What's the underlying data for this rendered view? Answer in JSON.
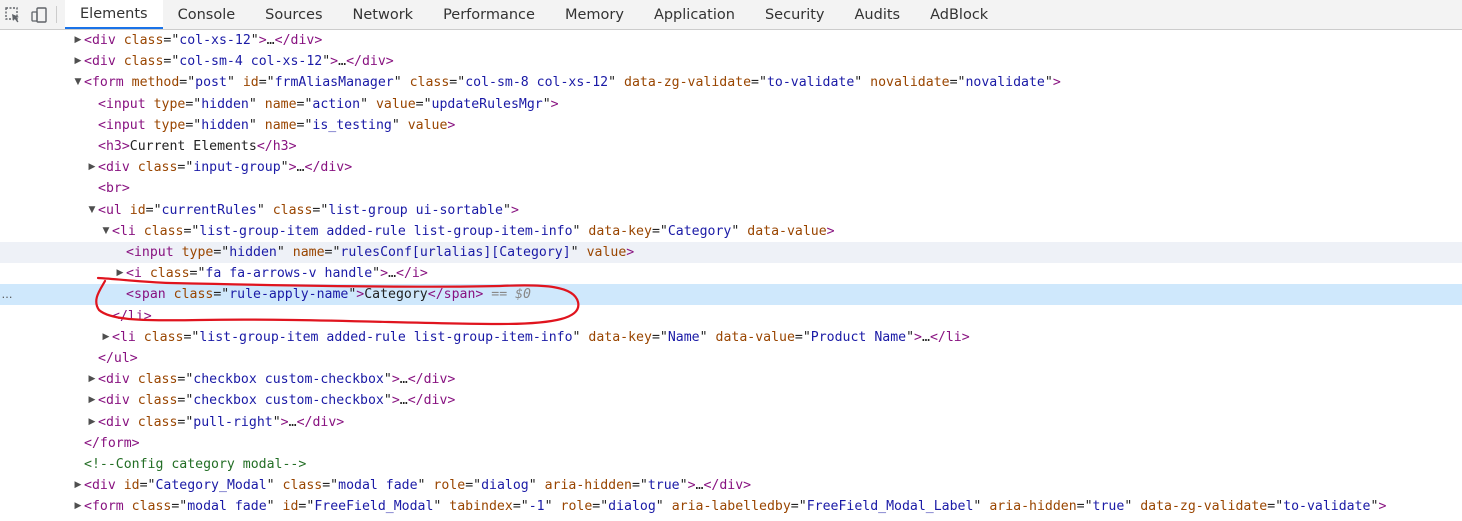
{
  "toolbar": {
    "icons": [
      "inspect-element-icon",
      "device-toggle-icon"
    ],
    "tabs": [
      {
        "label": "Elements",
        "active": true
      },
      {
        "label": "Console"
      },
      {
        "label": "Sources"
      },
      {
        "label": "Network"
      },
      {
        "label": "Performance"
      },
      {
        "label": "Memory"
      },
      {
        "label": "Application"
      },
      {
        "label": "Security"
      },
      {
        "label": "Audits"
      },
      {
        "label": "AdBlock"
      }
    ]
  },
  "colors": {
    "tag": "#881280",
    "attr_name": "#994500",
    "attr_value": "#1a1aa6",
    "comment": "#236e25",
    "selection": "#cfe8fc",
    "annotation": "#e0141e"
  },
  "tree": [
    {
      "depth": 0,
      "tri": "closed",
      "tag": "div",
      "attrs": [
        [
          "class",
          "col-xs-12"
        ]
      ],
      "collapsed": true
    },
    {
      "depth": 0,
      "tri": "closed",
      "tag": "div",
      "attrs": [
        [
          "class",
          "col-sm-4 col-xs-12"
        ]
      ],
      "collapsed": true
    },
    {
      "depth": 0,
      "tri": "open",
      "tag": "form",
      "attrs": [
        [
          "method",
          "post"
        ],
        [
          "id",
          "frmAliasManager"
        ],
        [
          "class",
          "col-sm-8 col-xs-12"
        ],
        [
          "data-zg-validate",
          "to-validate"
        ],
        [
          "novalidate",
          "novalidate"
        ]
      ]
    },
    {
      "depth": 1,
      "tag": "input",
      "attrs": [
        [
          "type",
          "hidden"
        ],
        [
          "name",
          "action"
        ],
        [
          "value",
          "updateRulesMgr"
        ]
      ]
    },
    {
      "depth": 1,
      "tag": "input",
      "attrs": [
        [
          "type",
          "hidden"
        ],
        [
          "name",
          "is_testing"
        ],
        [
          "value",
          null
        ]
      ]
    },
    {
      "depth": 1,
      "tag": "h3",
      "text": "Current Elements",
      "close": "h3"
    },
    {
      "depth": 1,
      "tri": "closed",
      "tag": "div",
      "attrs": [
        [
          "class",
          "input-group"
        ]
      ],
      "collapsed": true
    },
    {
      "depth": 1,
      "tag": "br"
    },
    {
      "depth": 1,
      "tri": "open",
      "tag": "ul",
      "attrs": [
        [
          "id",
          "currentRules"
        ],
        [
          "class",
          "list-group ui-sortable"
        ]
      ]
    },
    {
      "depth": 2,
      "tri": "open",
      "tag": "li",
      "attrs": [
        [
          "class",
          "list-group-item added-rule list-group-item-info"
        ],
        [
          "data-key",
          "Category"
        ],
        [
          "data-value",
          null
        ]
      ]
    },
    {
      "depth": 3,
      "tag": "input",
      "attrs": [
        [
          "type",
          "hidden"
        ],
        [
          "name",
          "rulesConf[urlalias][Category]"
        ],
        [
          "value",
          null
        ]
      ],
      "hover": true
    },
    {
      "depth": 3,
      "tri": "closed",
      "tag": "i",
      "attrs": [
        [
          "class",
          "fa fa-arrows-v handle"
        ]
      ],
      "collapsed": true
    },
    {
      "depth": 3,
      "tag": "span",
      "attrs": [
        [
          "class",
          "rule-apply-name"
        ]
      ],
      "text": "Category",
      "close": "span",
      "selected": true,
      "suffix": " == $0"
    },
    {
      "depth": 2,
      "closing": "li"
    },
    {
      "depth": 2,
      "tri": "closed",
      "tag": "li",
      "attrs": [
        [
          "class",
          "list-group-item added-rule list-group-item-info"
        ],
        [
          "data-key",
          "Name"
        ],
        [
          "data-value",
          "Product Name"
        ]
      ],
      "collapsed": true
    },
    {
      "depth": 1,
      "closing": "ul"
    },
    {
      "depth": 1,
      "tri": "closed",
      "tag": "div",
      "attrs": [
        [
          "class",
          "checkbox custom-checkbox"
        ]
      ],
      "collapsed": true
    },
    {
      "depth": 1,
      "tri": "closed",
      "tag": "div",
      "attrs": [
        [
          "class",
          "checkbox custom-checkbox"
        ]
      ],
      "collapsed": true
    },
    {
      "depth": 1,
      "tri": "closed",
      "tag": "div",
      "attrs": [
        [
          "class",
          "pull-right"
        ]
      ],
      "collapsed": true
    },
    {
      "depth": 0,
      "closing": "form"
    },
    {
      "depth": 0,
      "comment": "Config category modal"
    },
    {
      "depth": 0,
      "tri": "closed",
      "tag": "div",
      "attrs": [
        [
          "id",
          "Category_Modal"
        ],
        [
          "class",
          "modal fade"
        ],
        [
          "role",
          "dialog"
        ],
        [
          "aria-hidden",
          "true"
        ]
      ],
      "collapsed": true
    },
    {
      "depth": 0,
      "tri": "closed",
      "tag": "form",
      "attrs": [
        [
          "class",
          "modal fade"
        ],
        [
          "id",
          "FreeField_Modal"
        ],
        [
          "tabindex",
          "-1"
        ],
        [
          "role",
          "dialog"
        ],
        [
          "aria-labelledby",
          "FreeField_Modal_Label"
        ],
        [
          "aria-hidden",
          "true"
        ],
        [
          "data-zg-validate",
          "to-validate"
        ]
      ]
    }
  ]
}
